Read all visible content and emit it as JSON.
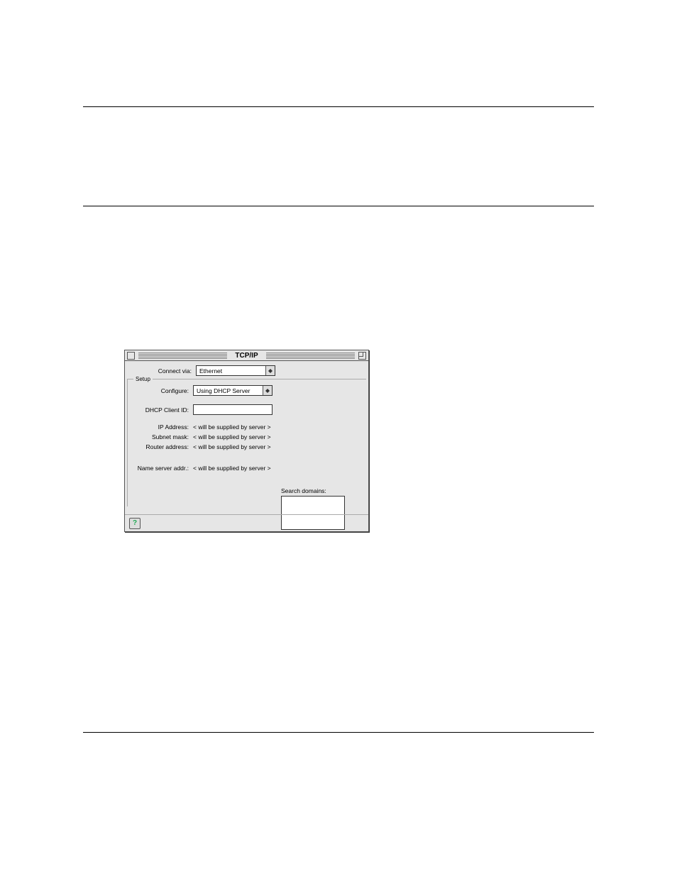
{
  "window": {
    "title": "TCP/IP",
    "connect_via": {
      "label": "Connect via:",
      "value": "Ethernet"
    },
    "setup_label": "Setup",
    "configure": {
      "label": "Configure:",
      "value": "Using DHCP Server"
    },
    "dhcp_client_id": {
      "label": "DHCP Client ID:",
      "value": ""
    },
    "ip_address": {
      "label": "IP Address:",
      "value": "< will be supplied by server >"
    },
    "subnet_mask": {
      "label": "Subnet mask:",
      "value": "< will be supplied by server >"
    },
    "router_address": {
      "label": "Router address:",
      "value": "< will be supplied by server >"
    },
    "name_server": {
      "label": "Name server addr.:",
      "value": "< will be supplied by server >"
    },
    "search_domains": {
      "label": "Search domains:",
      "value": ""
    },
    "help_button": "?"
  }
}
